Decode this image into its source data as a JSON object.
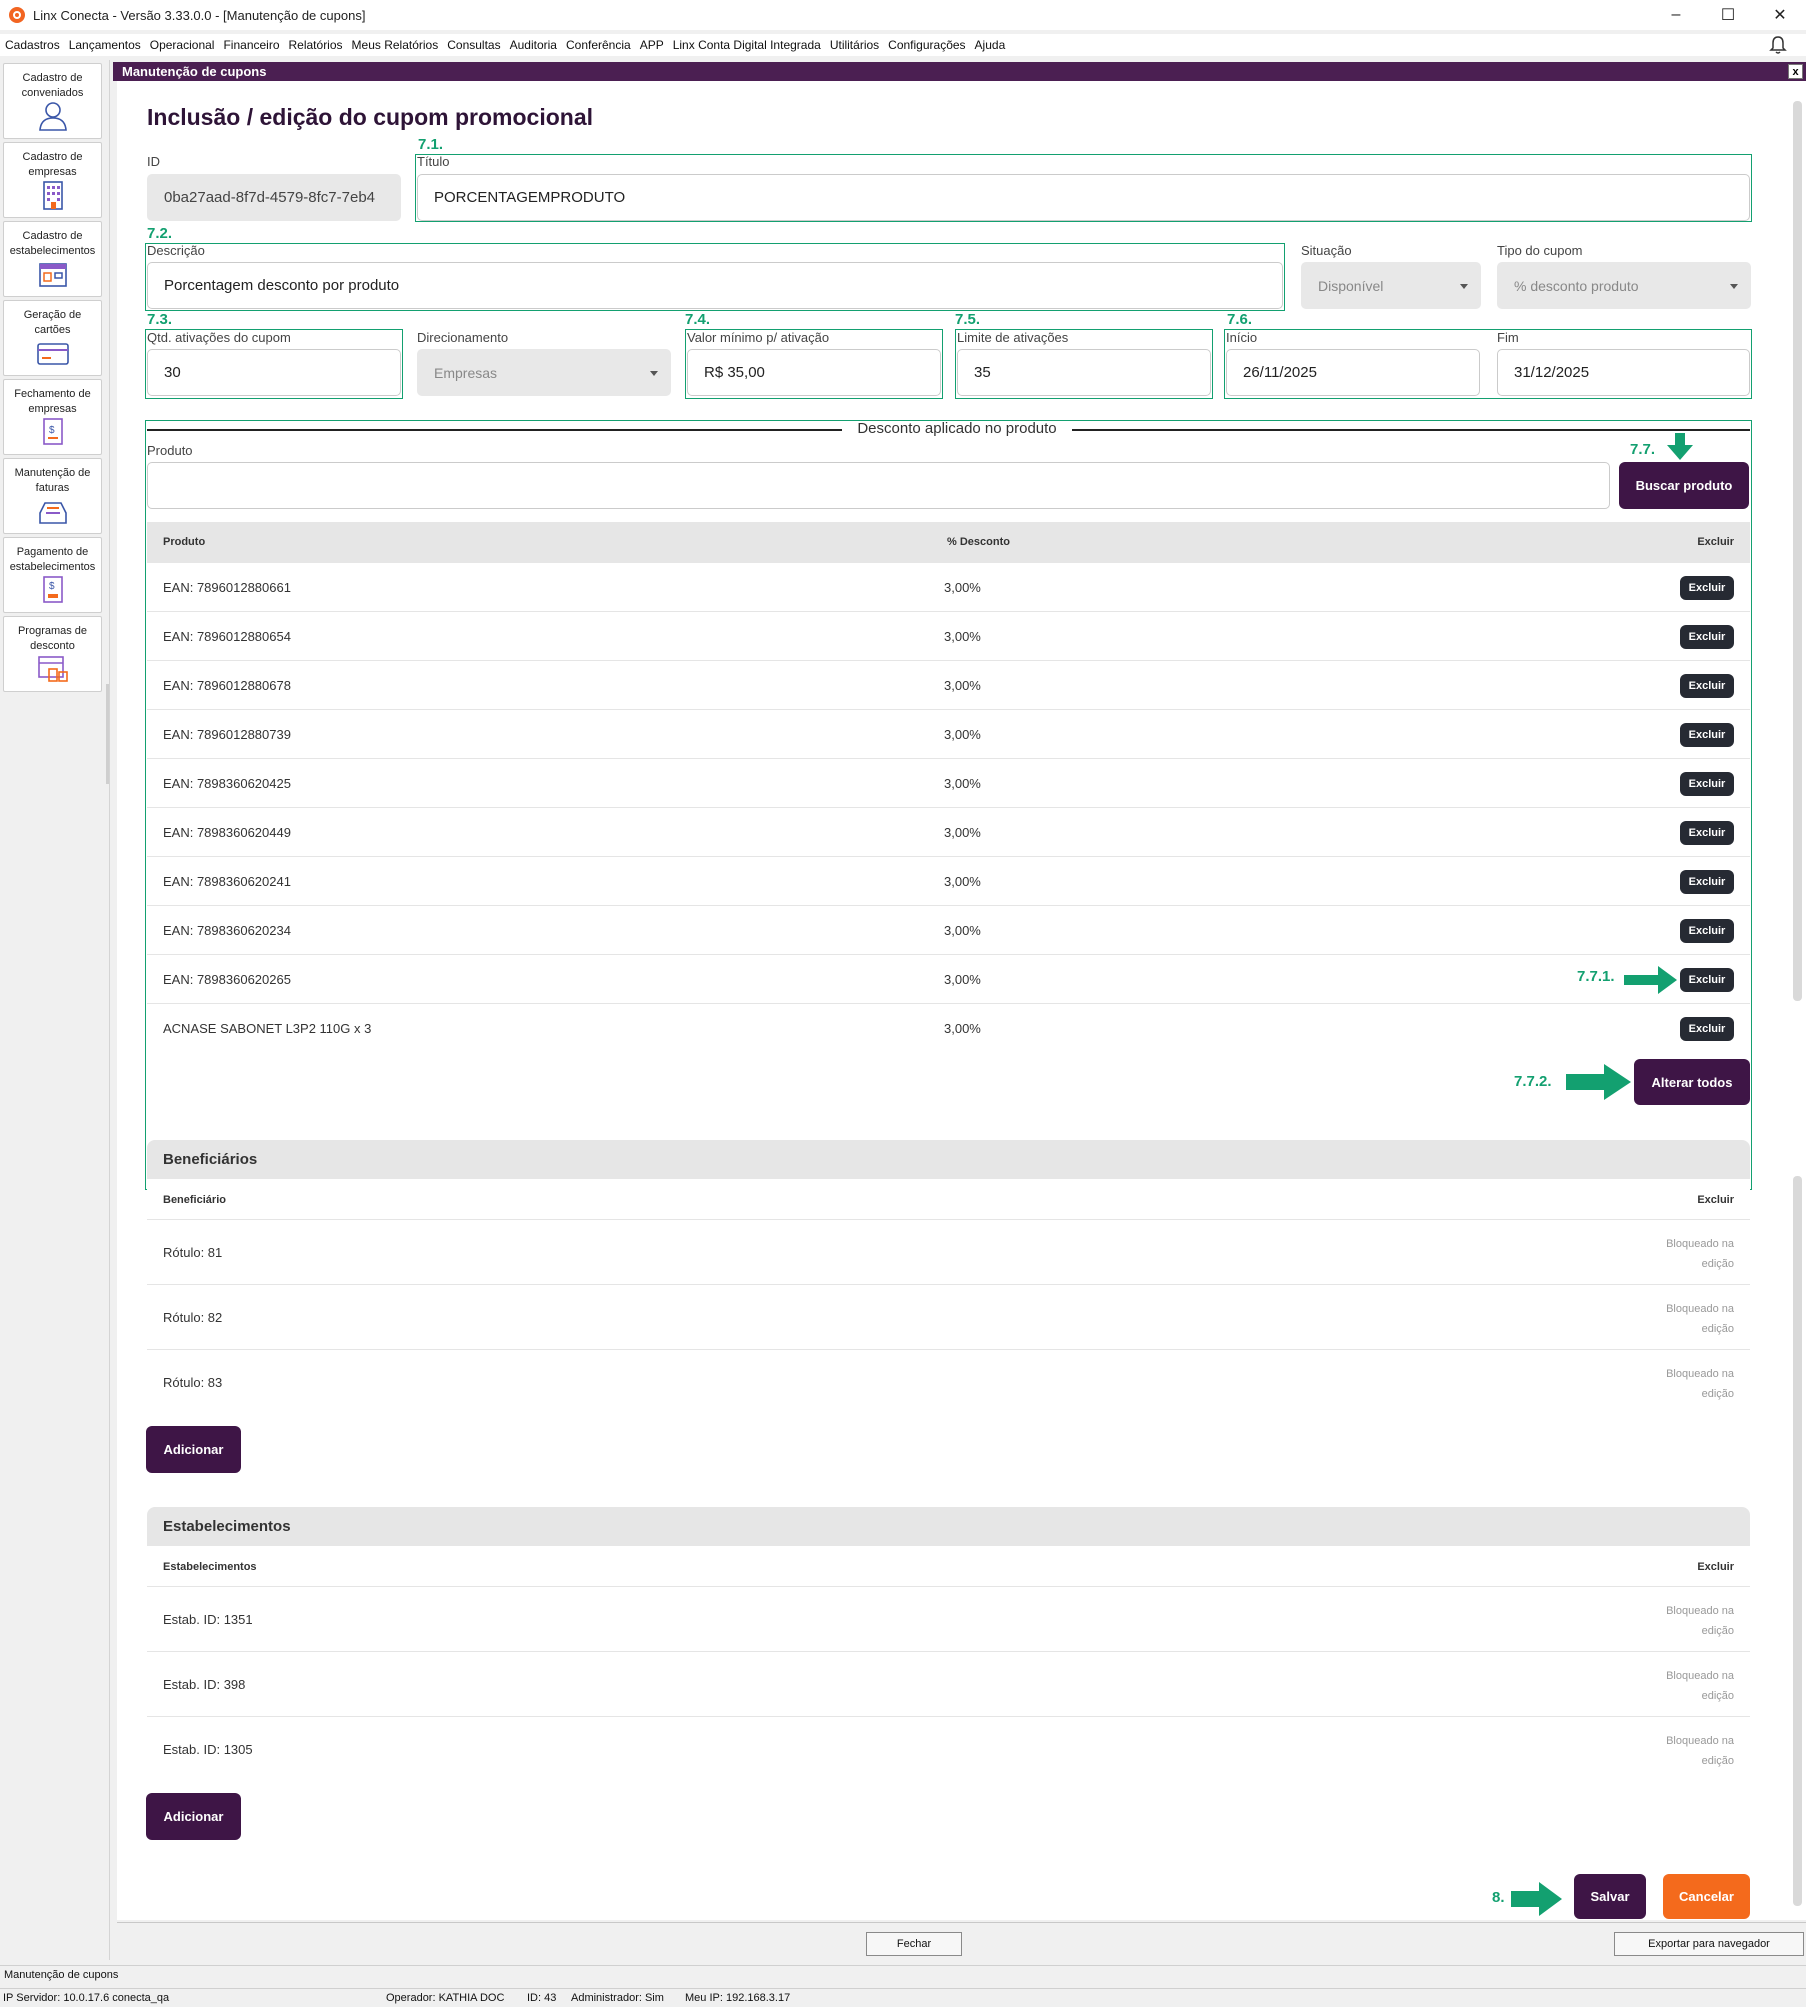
{
  "window": {
    "title": "Linx Conecta - Versão 3.33.0.0 - [Manutenção de cupons]"
  },
  "menu": [
    "Cadastros",
    "Lançamentos",
    "Operacional",
    "Financeiro",
    "Relatórios",
    "Meus Relatórios",
    "Consultas",
    "Auditoria",
    "Conferência",
    "APP",
    "Linx Conta Digital Integrada",
    "Utilitários",
    "Configurações",
    "Ajuda"
  ],
  "sidebar": [
    {
      "label": "Cadastro de conveniados",
      "icon": "user-icon"
    },
    {
      "label": "Cadastro de empresas",
      "icon": "building-icon"
    },
    {
      "label": "Cadastro de estabelecimentos",
      "icon": "store-icon"
    },
    {
      "label": "Geração de cartões",
      "icon": "card-icon"
    },
    {
      "label": "Fechamento de empresas",
      "icon": "invoice-icon"
    },
    {
      "label": "Manutenção de faturas",
      "icon": "tray-icon"
    },
    {
      "label": "Pagamento de estabelecimentos",
      "icon": "payment-icon"
    },
    {
      "label": "Programas de desconto",
      "icon": "discount-icon"
    }
  ],
  "inner": {
    "title": "Manutenção de cupons",
    "close": "x"
  },
  "form": {
    "title": "Inclusão / edição do cupom promocional",
    "id_label": "ID",
    "id_value": "0ba27aad-8f7d-4579-8fc7-7eb4",
    "titulo_label": "Título",
    "titulo_value": "PORCENTAGEMPRODUTO",
    "descricao_label": "Descrição",
    "descricao_value": "Porcentagem desconto por produto",
    "situacao_label": "Situação",
    "situacao_value": "Disponível",
    "tipo_label": "Tipo do cupom",
    "tipo_value": "% desconto produto",
    "qtd_label": "Qtd. ativações do cupom",
    "qtd_value": "30",
    "direcionamento_label": "Direcionamento",
    "direcionamento_value": "Empresas",
    "valor_label": "Valor mínimo p/ ativação",
    "valor_value": "R$ 35,00",
    "limite_label": "Limite de ativações",
    "limite_value": "35",
    "inicio_label": "Início",
    "inicio_value": "26/11/2025",
    "fim_label": "Fim",
    "fim_value": "31/12/2025"
  },
  "annotations": {
    "a71": "7.1.",
    "a72": "7.2.",
    "a73": "7.3.",
    "a74": "7.4.",
    "a75": "7.5.",
    "a76": "7.6.",
    "a77": "7.7.",
    "a771": "7.7.1.",
    "a772": "7.7.2.",
    "a8": "8."
  },
  "discount": {
    "section_title": "Desconto aplicado no produto",
    "produto_label": "Produto",
    "buscar": "Buscar produto",
    "col_produto": "Produto",
    "col_desconto": "% Desconto",
    "col_excluir": "Excluir",
    "excluir_btn": "Excluir",
    "rows": [
      {
        "produto": "EAN: 7896012880661",
        "desconto": "3,00%"
      },
      {
        "produto": "EAN: 7896012880654",
        "desconto": "3,00%"
      },
      {
        "produto": "EAN: 7896012880678",
        "desconto": "3,00%"
      },
      {
        "produto": "EAN: 7896012880739",
        "desconto": "3,00%"
      },
      {
        "produto": "EAN: 7898360620425",
        "desconto": "3,00%"
      },
      {
        "produto": "EAN: 7898360620449",
        "desconto": "3,00%"
      },
      {
        "produto": "EAN: 7898360620241",
        "desconto": "3,00%"
      },
      {
        "produto": "EAN: 7898360620234",
        "desconto": "3,00%"
      },
      {
        "produto": "EAN: 7898360620265",
        "desconto": "3,00%"
      },
      {
        "produto": "ACNASE SABONET L3P2 110G x 3",
        "desconto": "3,00%"
      }
    ],
    "alterar_todos": "Alterar todos"
  },
  "beneficiarios": {
    "title": "Beneficiários",
    "col_a": "Beneficiário",
    "col_b": "Excluir",
    "rows": [
      {
        "nome": "Rótulo: 81",
        "status": "Bloqueado na edição"
      },
      {
        "nome": "Rótulo: 82",
        "status": "Bloqueado na edição"
      },
      {
        "nome": "Rótulo: 83",
        "status": "Bloqueado na edição"
      }
    ],
    "adicionar": "Adicionar"
  },
  "estabelecimentos": {
    "title": "Estabelecimentos",
    "col_a": "Estabelecimentos",
    "col_b": "Excluir",
    "rows": [
      {
        "nome": "Estab. ID: 1351",
        "status": "Bloqueado na edição"
      },
      {
        "nome": "Estab. ID: 398",
        "status": "Bloqueado na edição"
      },
      {
        "nome": "Estab. ID: 1305",
        "status": "Bloqueado na edição"
      }
    ],
    "adicionar": "Adicionar"
  },
  "actions": {
    "salvar": "Salvar",
    "cancelar": "Cancelar"
  },
  "footer": {
    "fechar": "Fechar",
    "exportar": "Exportar para navegador"
  },
  "taskbar": {
    "tab": "Manutenção de cupons"
  },
  "status": {
    "servidor": "IP Servidor: 10.0.17.6 conecta_qa",
    "operador": "Operador: KATHIA DOC",
    "id": "ID: 43",
    "admin": "Administrador: Sim",
    "meu_ip": "Meu IP: 192.168.3.17"
  },
  "colors": {
    "brand": "#3e1546",
    "accent": "#f46a1c",
    "annotation": "#13a070"
  }
}
